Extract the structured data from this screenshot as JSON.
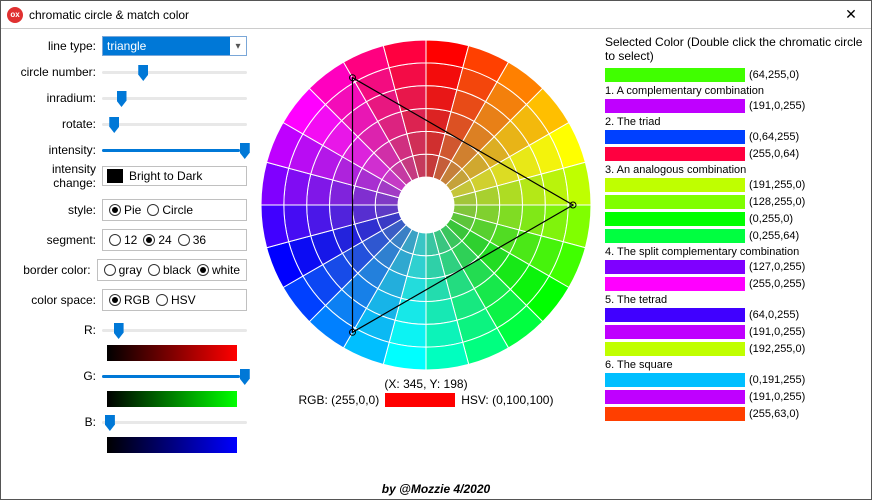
{
  "window": {
    "title": "chromatic circle & match color"
  },
  "controls": {
    "lineType": {
      "label": "line type:",
      "value": "triangle"
    },
    "circleNumber": {
      "label": "circle number:",
      "pos": 25
    },
    "inradium": {
      "label": "inradium:",
      "pos": 10
    },
    "rotate": {
      "label": "rotate:",
      "pos": 5
    },
    "intensity": {
      "label": "intensity:",
      "pos": 95
    },
    "intensityChange": {
      "label": "intensity change:",
      "swatch": "#000000",
      "text": "Bright to Dark"
    },
    "style": {
      "label": "style:",
      "options": [
        {
          "label": "Pie",
          "selected": true
        },
        {
          "label": "Circle",
          "selected": false
        }
      ]
    },
    "segment": {
      "label": "segment:",
      "options": [
        {
          "label": "12",
          "selected": false
        },
        {
          "label": "24",
          "selected": true
        },
        {
          "label": "36",
          "selected": false
        }
      ]
    },
    "borderColor": {
      "label": "border color:",
      "options": [
        {
          "label": "gray",
          "selected": false
        },
        {
          "label": "black",
          "selected": false
        },
        {
          "label": "white",
          "selected": true
        }
      ]
    },
    "colorSpace": {
      "label": "color space:",
      "options": [
        {
          "label": "RGB",
          "selected": true
        },
        {
          "label": "HSV",
          "selected": false
        }
      ]
    },
    "R": {
      "label": "R:",
      "pos": 8,
      "grad": [
        "#000000",
        "#ff0000"
      ]
    },
    "G": {
      "label": "G:",
      "pos": 95,
      "grad": [
        "#000000",
        "#00ff00"
      ]
    },
    "B": {
      "label": "B:",
      "pos": 2,
      "grad": [
        "#000000",
        "#0000ff"
      ]
    }
  },
  "wheel": {
    "readoutXY": "(X: 345, Y: 198)",
    "rgbLabel": "RGB: (255,0,0)",
    "rgbSwatch": "#ff0000",
    "hsvLabel": "HSV: (0,100,100)"
  },
  "selected": {
    "title": "Selected Color (Double click the chromatic circle to select)",
    "mainSwatch": "#40ff00",
    "mainLabel": "(64,255,0)",
    "groups": [
      {
        "title": "1. A complementary combination",
        "rows": [
          {
            "c": "#bf00ff",
            "l": "(191,0,255)"
          }
        ]
      },
      {
        "title": "2. The triad",
        "rows": [
          {
            "c": "#0040ff",
            "l": "(0,64,255)"
          },
          {
            "c": "#ff0040",
            "l": "(255,0,64)"
          }
        ]
      },
      {
        "title": "3. An analogous combination",
        "rows": [
          {
            "c": "#bfff00",
            "l": "(191,255,0)"
          },
          {
            "c": "#80ff00",
            "l": "(128,255,0)"
          },
          {
            "c": "#00ff00",
            "l": "(0,255,0)"
          },
          {
            "c": "#00ff40",
            "l": "(0,255,64)"
          }
        ]
      },
      {
        "title": "4. The split complementary combination",
        "rows": [
          {
            "c": "#7f00ff",
            "l": "(127,0,255)"
          },
          {
            "c": "#ff00ff",
            "l": "(255,0,255)"
          }
        ]
      },
      {
        "title": "5. The tetrad",
        "rows": [
          {
            "c": "#4000ff",
            "l": "(64,0,255)"
          },
          {
            "c": "#bf00ff",
            "l": "(191,0,255)"
          },
          {
            "c": "#c0ff00",
            "l": "(192,255,0)"
          }
        ]
      },
      {
        "title": "6. The square",
        "rows": [
          {
            "c": "#00bfff",
            "l": "(0,191,255)"
          },
          {
            "c": "#bf00ff",
            "l": "(191,0,255)"
          },
          {
            "c": "#ff3f00",
            "l": "(255,63,0)"
          }
        ]
      }
    ]
  },
  "footer": "by @Mozzie 4/2020",
  "chart_data": {
    "type": "pie",
    "title": "chromatic color wheel",
    "segments": 24,
    "rings": 6,
    "colors_outer_ring_hue_deg": [
      0,
      15,
      30,
      45,
      60,
      75,
      90,
      105,
      120,
      135,
      150,
      165,
      180,
      195,
      210,
      225,
      240,
      255,
      270,
      285,
      300,
      315,
      330,
      345
    ],
    "triangle_vertices_approx_hue_deg": [
      90,
      210,
      330
    ]
  }
}
